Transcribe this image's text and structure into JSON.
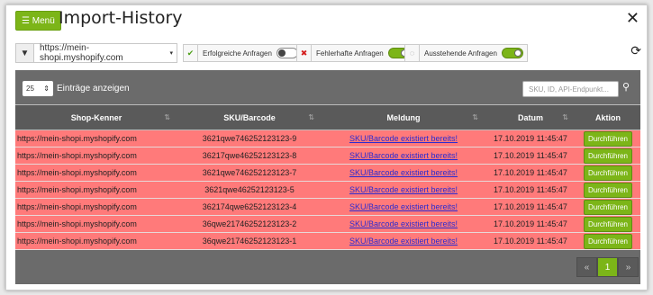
{
  "header": {
    "menu_label": "☰ Menü",
    "title": "Import-History",
    "close_glyph": "✕"
  },
  "filters": {
    "shop_select": "https://mein-shopi.myshopify.com",
    "toggles": [
      {
        "icon": "check-icon",
        "label": "Erfolgreiche Anfragen",
        "state": "off"
      },
      {
        "icon": "x-icon",
        "label": "Fehlerhafte Anfragen",
        "state": "on"
      },
      {
        "icon": "pending-icon",
        "label": "Ausstehende Anfragen",
        "state": "on"
      }
    ]
  },
  "table_controls": {
    "page_size": "25",
    "entries_label": "Einträge anzeigen",
    "search_placeholder": "SKU, ID, API-Endpunkt..."
  },
  "columns": [
    "Shop-Kenner",
    "SKU/Barcode",
    "Meldung",
    "Datum",
    "Aktion"
  ],
  "rows": [
    {
      "shop": "https://mein-shopi.myshopify.com",
      "sku": "3621qwe746252123123-9",
      "msg": "SKU/Barcode existiert bereits!",
      "date": "17.10.2019 11:45:47",
      "action": "Durchführen"
    },
    {
      "shop": "https://mein-shopi.myshopify.com",
      "sku": "36217qwe46252123123-8",
      "msg": "SKU/Barcode existiert bereits!",
      "date": "17.10.2019 11:45:47",
      "action": "Durchführen"
    },
    {
      "shop": "https://mein-shopi.myshopify.com",
      "sku": "3621qwe746252123123-7",
      "msg": "SKU/Barcode existiert bereits!",
      "date": "17.10.2019 11:45:47",
      "action": "Durchführen"
    },
    {
      "shop": "https://mein-shopi.myshopify.com",
      "sku": "3621qwe46252123123-5",
      "msg": "SKU/Barcode existiert bereits!",
      "date": "17.10.2019 11:45:47",
      "action": "Durchführen"
    },
    {
      "shop": "https://mein-shopi.myshopify.com",
      "sku": "362174qwe6252123123-4",
      "msg": "SKU/Barcode existiert bereits!",
      "date": "17.10.2019 11:45:47",
      "action": "Durchführen"
    },
    {
      "shop": "https://mein-shopi.myshopify.com",
      "sku": "36qwe21746252123123-2",
      "msg": "SKU/Barcode existiert bereits!",
      "date": "17.10.2019 11:45:47",
      "action": "Durchführen"
    },
    {
      "shop": "https://mein-shopi.myshopify.com",
      "sku": "36qwe21746252123123-1",
      "msg": "SKU/Barcode existiert bereits!",
      "date": "17.10.2019 11:45:47",
      "action": "Durchführen"
    }
  ],
  "pagination": {
    "prev": "«",
    "current": "1",
    "next": "»"
  },
  "colors": {
    "accent": "#7cb518",
    "error_row": "#ff7a7a",
    "panel": "#6b6b6b"
  }
}
